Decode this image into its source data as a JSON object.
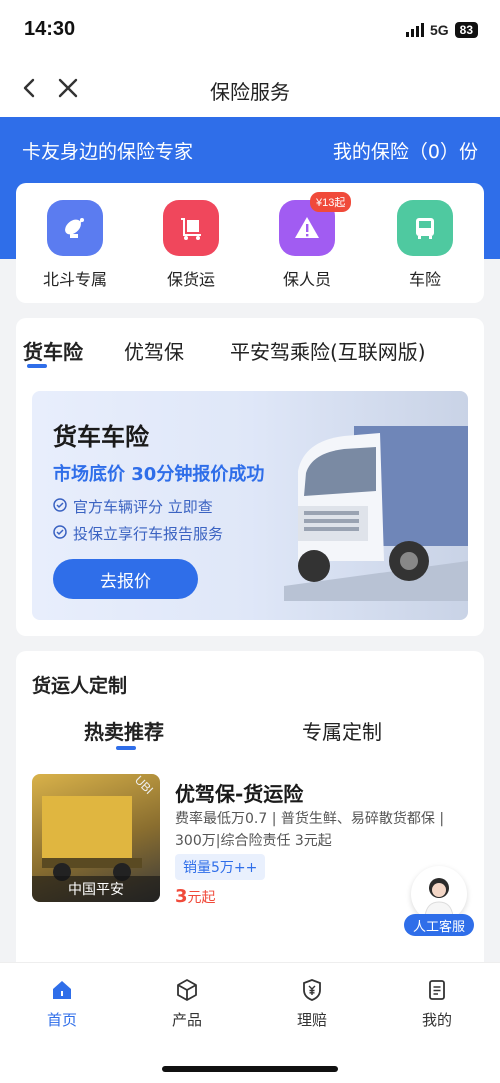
{
  "status_bar": {
    "time": "14:30",
    "network": "5G",
    "battery": "83"
  },
  "nav": {
    "title": "保险服务",
    "back_icon": "chevron-left-icon",
    "close_icon": "close-icon"
  },
  "banner": {
    "slogan": "卡友身边的保险专家",
    "my_policy": "我的保险（0）份"
  },
  "quick_entries": [
    {
      "label": "北斗专属",
      "icon": "satellite-dish-icon",
      "color": "#5b7cf0"
    },
    {
      "label": "保货运",
      "icon": "cargo-cart-icon",
      "color": "#f0475c"
    },
    {
      "label": "保人员",
      "icon": "warning-triangle-icon",
      "color": "#a15cf2",
      "badge": "¥13起"
    },
    {
      "label": "车险",
      "icon": "bus-icon",
      "color": "#4fc9a0"
    }
  ],
  "insurance_tabs": [
    {
      "label": "货车险",
      "active": true
    },
    {
      "label": "优驾保",
      "active": false
    },
    {
      "label": "平安驾乘险(互联网版)",
      "active": false
    }
  ],
  "promo": {
    "title": "货车车险",
    "subtitle": "市场底价 30分钟报价成功",
    "bullets": [
      "官方车辆评分  立即查",
      "投保立享行车报告服务"
    ],
    "button": "去报价"
  },
  "custom_section": {
    "title": "货运人定制",
    "tabs": [
      {
        "label": "热卖推荐",
        "active": true
      },
      {
        "label": "专属定制",
        "active": false
      }
    ],
    "products": [
      {
        "image_badge": "UBI",
        "image_label": "中国平安",
        "name": "优驾保-货运险",
        "desc": "费率最低万0.7 | 普货生鲜、易碎散货都保 | 300万|综合险责任 3元起",
        "tag": "销量5万++",
        "price_num": "3",
        "price_unit": "元起"
      }
    ]
  },
  "customer_service": {
    "label": "人工客服"
  },
  "tabbar": [
    {
      "label": "首页",
      "icon": "home-icon",
      "active": true
    },
    {
      "label": "产品",
      "icon": "cube-icon",
      "active": false
    },
    {
      "label": "理赔",
      "icon": "shield-yen-icon",
      "active": false
    },
    {
      "label": "我的",
      "icon": "document-icon",
      "active": false
    }
  ]
}
